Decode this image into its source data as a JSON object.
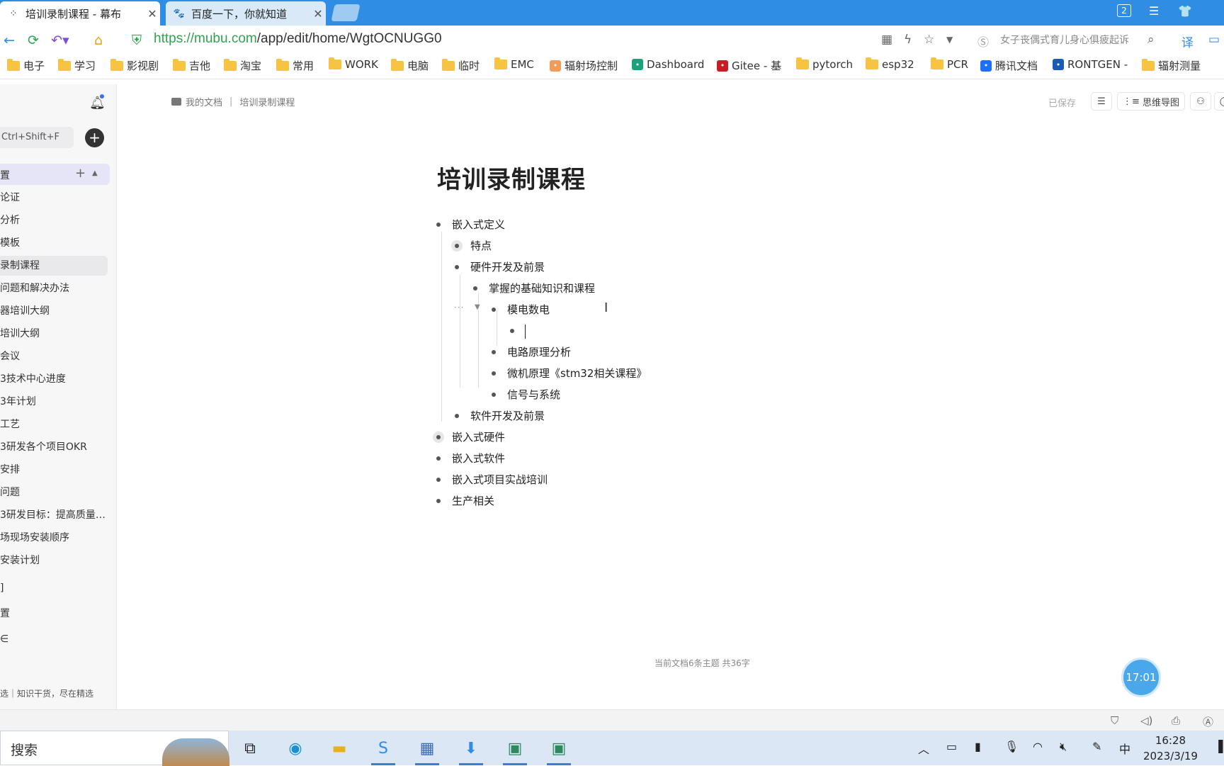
{
  "browser": {
    "tabs": [
      {
        "title": "培训录制课程 - 幕布",
        "icon": "mubu-icon",
        "close": "✕"
      },
      {
        "title": "百度一下，你就知道",
        "icon": "baidu-paw-icon",
        "close": "✕"
      }
    ],
    "window_badge": "2",
    "url_host": "https://mubu.com",
    "url_path": "/app/edit/home/WgtOCNUGG0",
    "search_placeholder": "女子丧偶式育儿身心俱疲起诉",
    "bookmarks": [
      {
        "label": "电子",
        "type": "folder"
      },
      {
        "label": "学习",
        "type": "folder"
      },
      {
        "label": "影视剧",
        "type": "folder"
      },
      {
        "label": "吉他",
        "type": "folder"
      },
      {
        "label": "淘宝",
        "type": "folder"
      },
      {
        "label": "常用",
        "type": "folder"
      },
      {
        "label": "WORK",
        "type": "folder"
      },
      {
        "label": "电脑",
        "type": "folder"
      },
      {
        "label": "临时",
        "type": "folder"
      },
      {
        "label": "EMC",
        "type": "folder"
      },
      {
        "label": "辐射场控制",
        "type": "site",
        "color": "#f39c5a"
      },
      {
        "label": "Dashboard",
        "type": "site",
        "color": "#1aa37a"
      },
      {
        "label": "Gitee - 基",
        "type": "site",
        "color": "#c71d23"
      },
      {
        "label": "pytorch",
        "type": "folder"
      },
      {
        "label": "esp32",
        "type": "folder"
      },
      {
        "label": "PCR",
        "type": "folder"
      },
      {
        "label": "腾讯文档",
        "type": "site",
        "color": "#1e6fff"
      },
      {
        "label": "RONTGEN -",
        "type": "site",
        "color": "#1a5bb5"
      },
      {
        "label": "辐射测量",
        "type": "folder"
      }
    ]
  },
  "sidebar": {
    "search_hint": "Ctrl+Shift+F",
    "add_label": "+",
    "group_label": "置",
    "items": [
      "论证",
      "分析",
      "模板",
      "录制课程",
      "问题和解决办法",
      "器培训大纲",
      "培训大纲",
      "会议",
      "3技术中心进度",
      "3年计划",
      "工艺",
      "3研发各个项目OKR",
      "安排",
      "问题",
      "3研发目标：提高质量…",
      "场现场安装顺序",
      "安装计划",
      "]",
      "置",
      "∈"
    ],
    "selected_index": 3,
    "footer": "选｜知识干货，尽在精选"
  },
  "editor": {
    "breadcrumb_root": "我的文档",
    "breadcrumb_current": "培训录制课程",
    "saved_status": "已保存",
    "mindmap_label": "思维导图",
    "title": "培训录制课程",
    "nodes": [
      {
        "text": "嵌入式定义",
        "level": 0
      },
      {
        "text": "特点",
        "level": 1,
        "collapsed": true
      },
      {
        "text": "硬件开发及前景",
        "level": 1
      },
      {
        "text": "掌握的基础知识和课程",
        "level": 2
      },
      {
        "text": "模电数电",
        "level": 3
      },
      {
        "text": "",
        "level": 4
      },
      {
        "text": "电路原理分析",
        "level": 3
      },
      {
        "text": "微机原理《stm32相关课程》",
        "level": 3
      },
      {
        "text": "信号与系统",
        "level": 3
      },
      {
        "text": "软件开发及前景",
        "level": 1
      },
      {
        "text": "嵌入式硬件",
        "level": 0,
        "collapsed": true
      },
      {
        "text": "嵌入式软件",
        "level": 0
      },
      {
        "text": "嵌入式项目实战培训",
        "level": 0
      },
      {
        "text": "生产相关",
        "level": 0
      }
    ],
    "word_count": "当前文档6条主题 共36字",
    "timer": "17:01"
  },
  "taskbar": {
    "search_label": "搜索",
    "ime": "中",
    "time": "16:28",
    "date": "2023/3/19"
  }
}
